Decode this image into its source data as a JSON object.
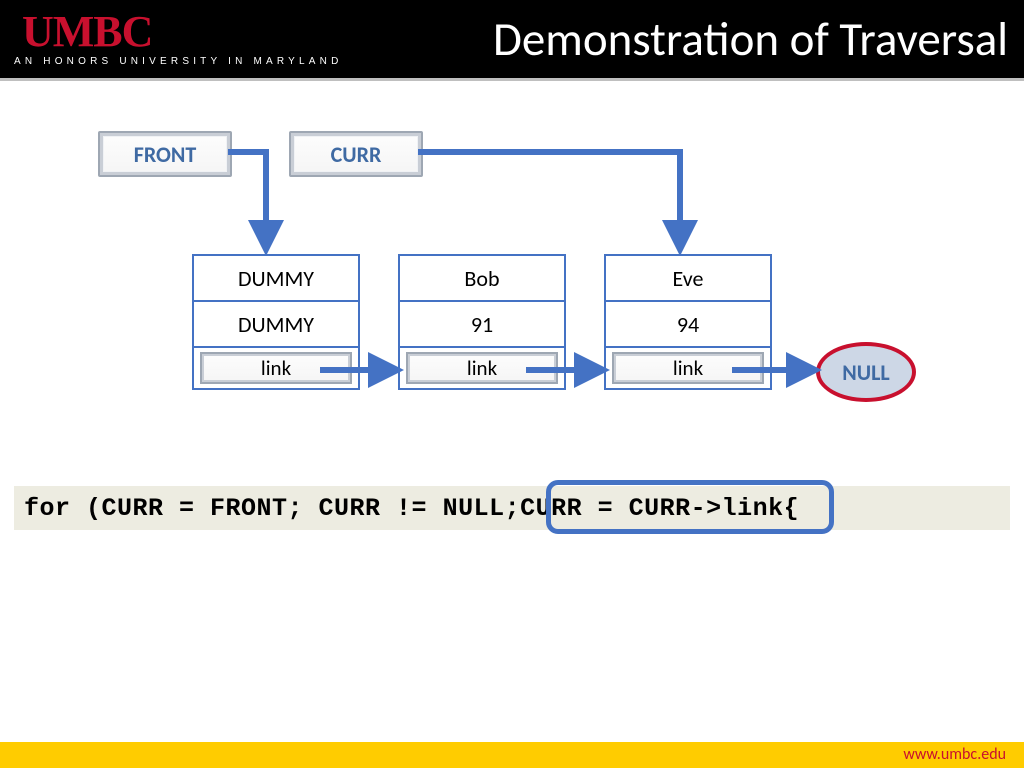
{
  "header": {
    "logo": "UMBC",
    "tagline": "AN HONORS UNIVERSITY IN MARYLAND",
    "title": "Demonstration of Traversal"
  },
  "pointers": {
    "front": "FRONT",
    "curr": "CURR"
  },
  "nodes": [
    {
      "name": "DUMMY",
      "value": "DUMMY",
      "link": "link"
    },
    {
      "name": "Bob",
      "value": "91",
      "link": "link"
    },
    {
      "name": "Eve",
      "value": "94",
      "link": "link"
    }
  ],
  "null_label": "NULL",
  "code": {
    "prefix": "for (CURR = FRONT; CURR != NULL; ",
    "highlight": "CURR = CURR->link",
    "suffix": "  {"
  },
  "footer": {
    "url": "www.umbc.edu"
  }
}
